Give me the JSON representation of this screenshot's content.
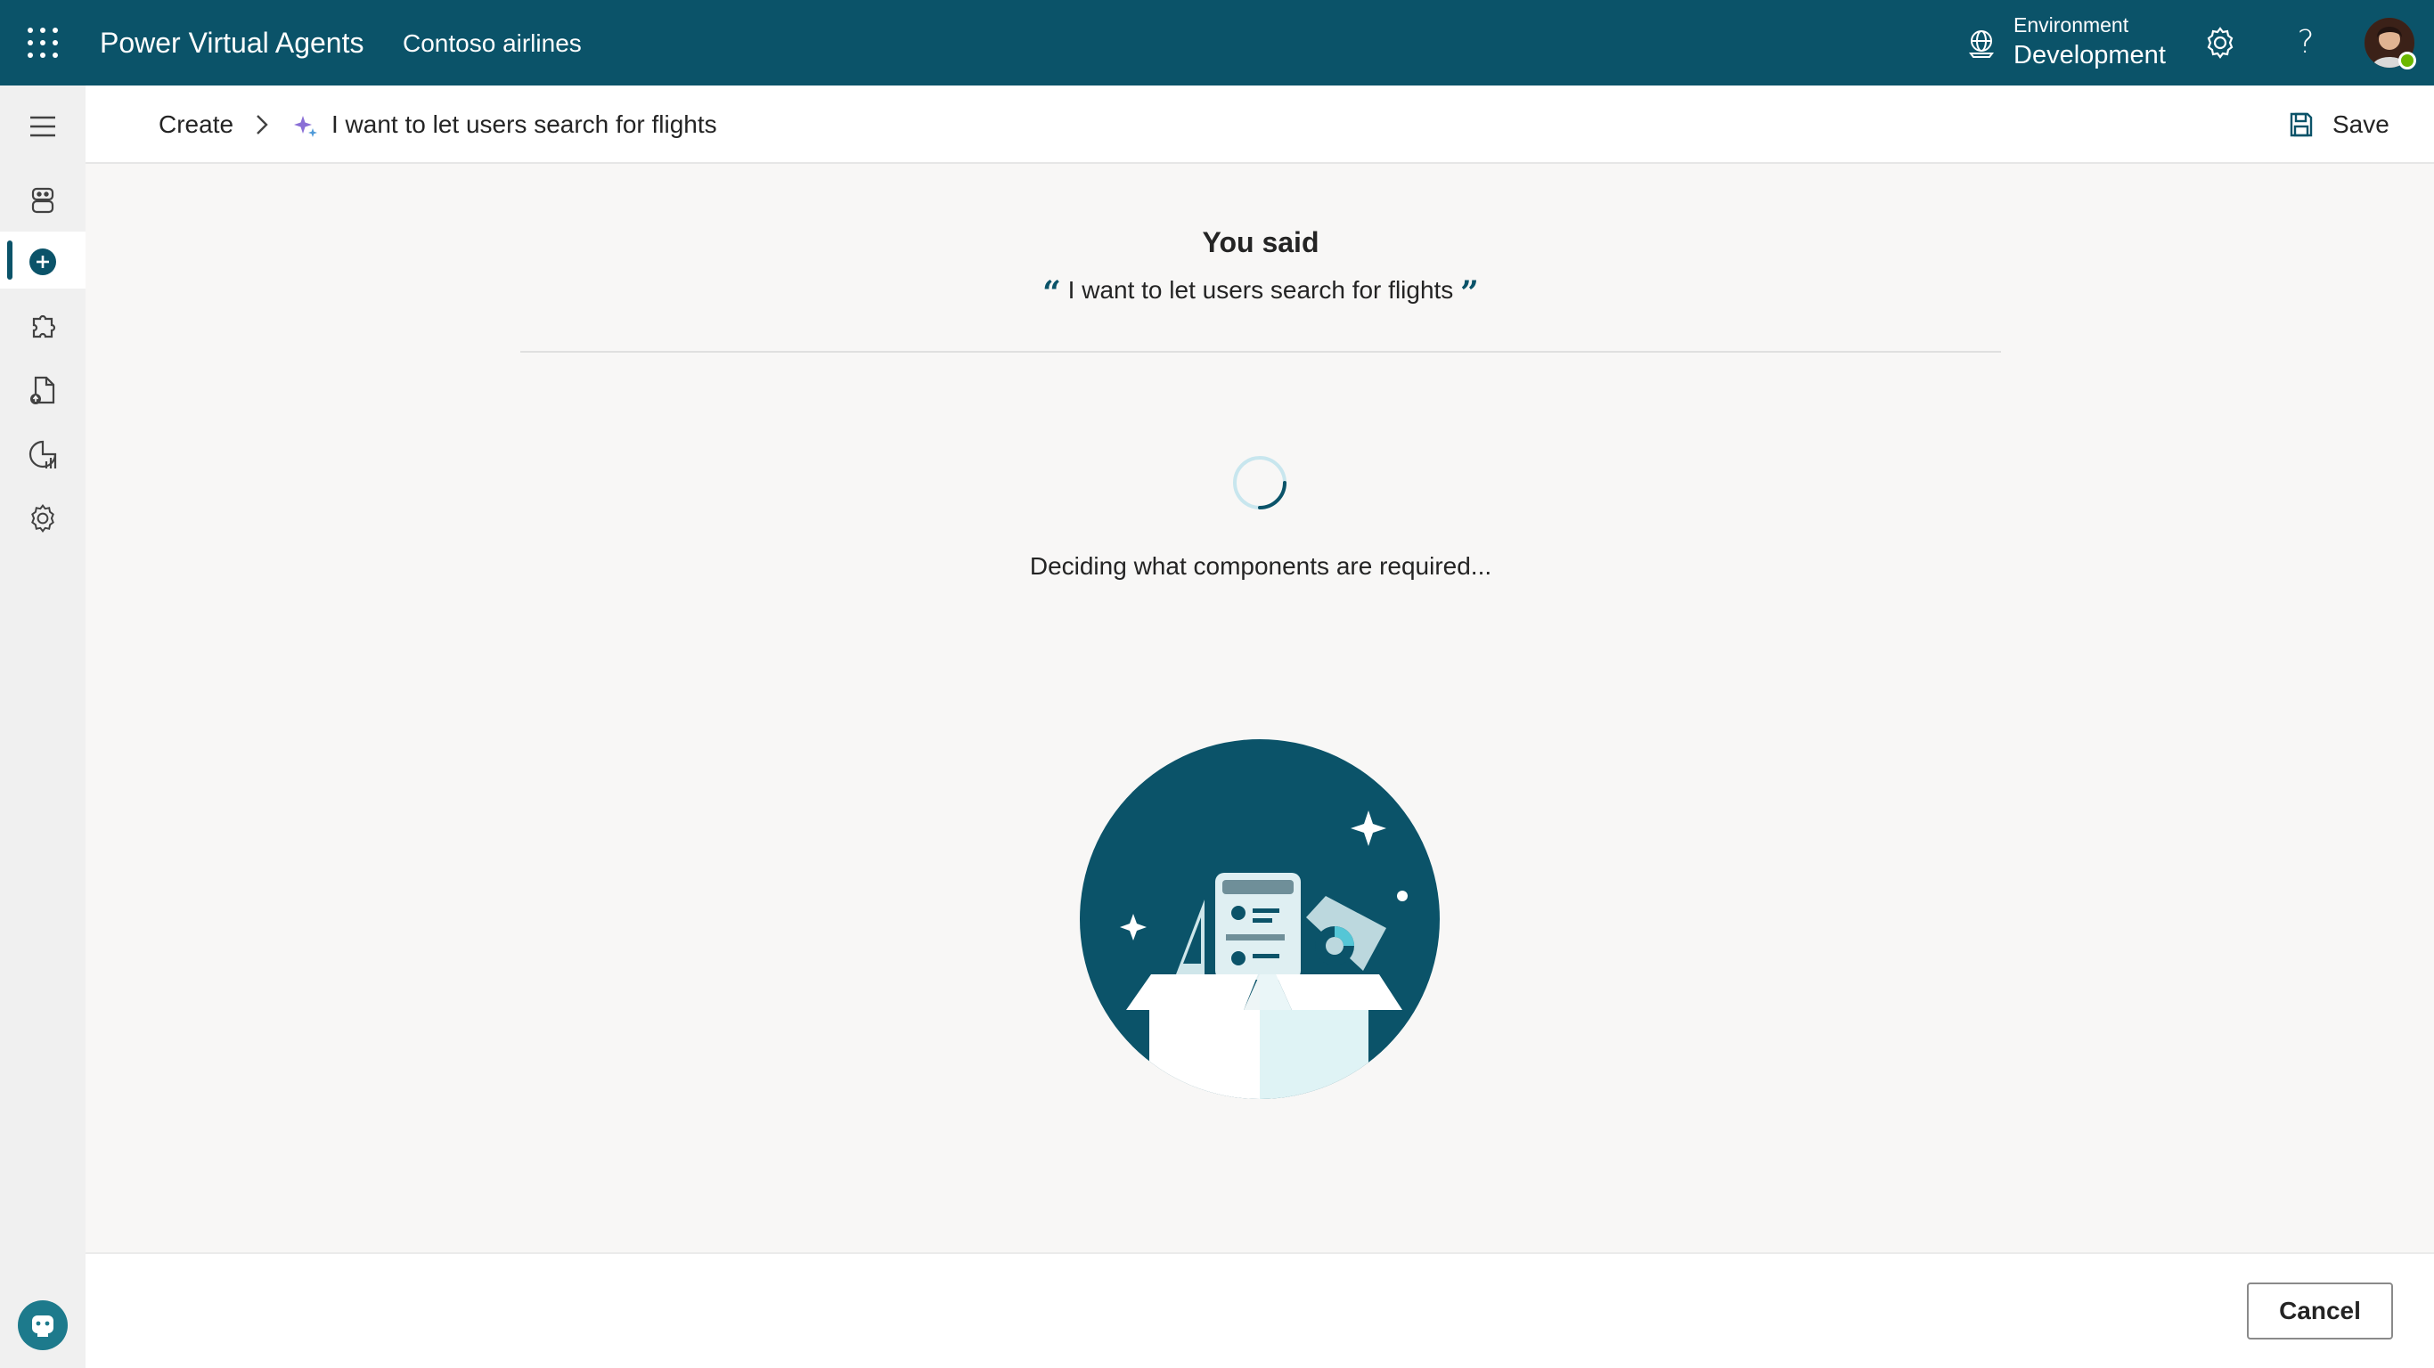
{
  "header": {
    "app_title": "Power Virtual Agents",
    "org_name": "Contoso airlines",
    "environment_label": "Environment",
    "environment_value": "Development",
    "help_glyph": "?",
    "brand_color": "#0b5369"
  },
  "sidebar": {
    "items": [
      {
        "icon": "menu-icon"
      },
      {
        "icon": "bot-icon"
      },
      {
        "icon": "add-circle-icon",
        "active": true
      },
      {
        "icon": "puzzle-icon"
      },
      {
        "icon": "document-icon"
      },
      {
        "icon": "analytics-icon"
      },
      {
        "icon": "gear-icon"
      }
    ],
    "bottom_icon": "chatbot-icon"
  },
  "breadcrumb": {
    "parent": "Create",
    "current": "I want to let users search for flights",
    "save_label": "Save"
  },
  "main": {
    "heading": "You said",
    "quote_open": "“",
    "quote_text": "I want to let users search for flights",
    "quote_close": "”",
    "status": "Deciding what components are required..."
  },
  "footer": {
    "cancel_label": "Cancel"
  }
}
